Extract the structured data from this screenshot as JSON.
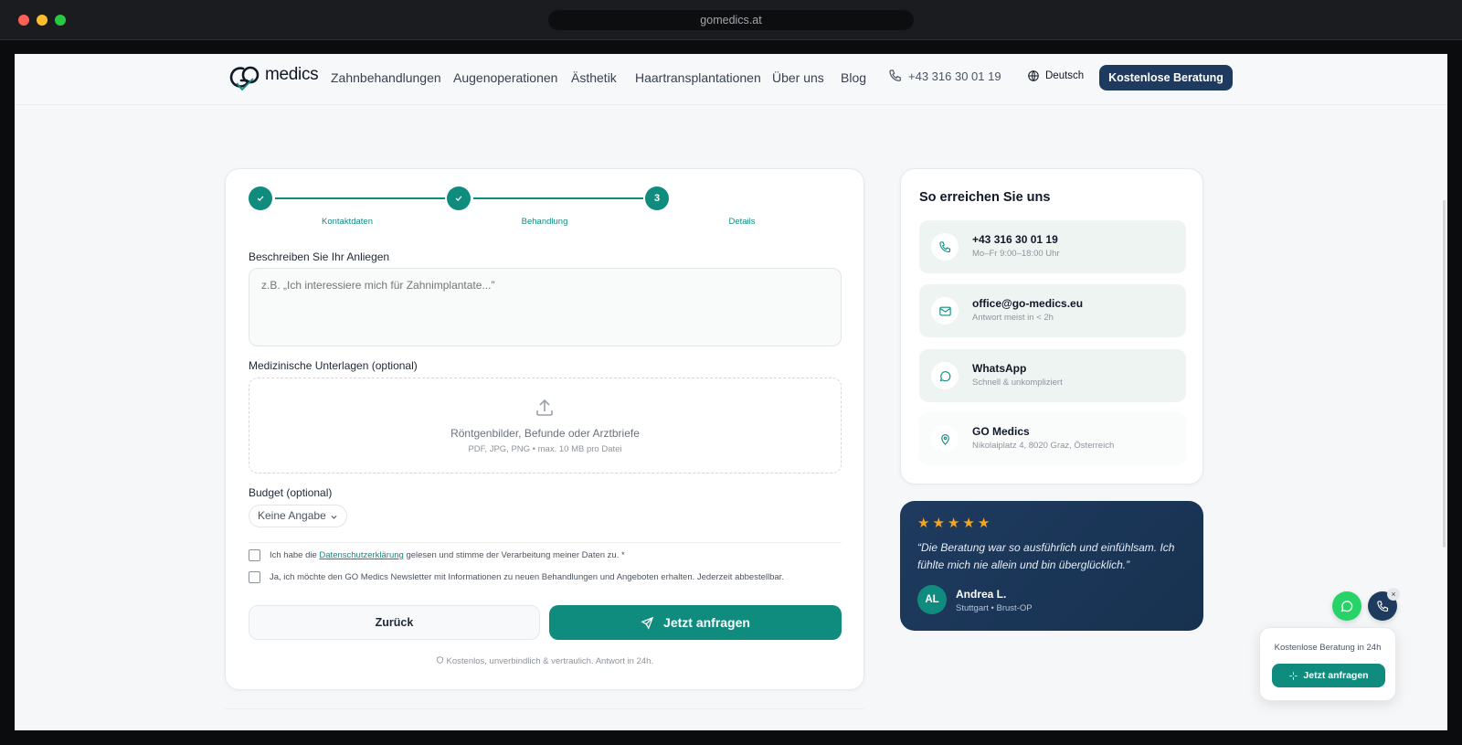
{
  "browser": {
    "url": "gomedics.at"
  },
  "header": {
    "logo_text": "medics",
    "nav": [
      "Zahnbehandlungen",
      "Augenoperationen",
      "Ästhetik",
      "Haartransplantationen",
      "Über uns",
      "Blog"
    ],
    "phone": "+43 316 30 01 19",
    "language": "Deutsch",
    "cta": "Kostenlose Beratung"
  },
  "form": {
    "steps": [
      {
        "number": "1",
        "label": "Kontaktdaten",
        "done": true
      },
      {
        "number": "2",
        "label": "Behandlung",
        "done": true
      },
      {
        "number": "3",
        "label": "Details",
        "done": false
      }
    ],
    "description_label": "Beschreiben Sie Ihr Anliegen",
    "description_placeholder": "z.B. „Ich interessiere mich für Zahnimplantate...\"",
    "upload_label": "Medizinische Unterlagen (optional)",
    "upload_title": "Röntgenbilder, Befunde oder Arztbriefe",
    "upload_sub": "PDF, JPG, PNG • max. 10 MB pro Datei",
    "budget_label": "Budget (optional)",
    "budget_value": "Keine Angabe",
    "privacy_pre": "Ich habe die ",
    "privacy_link": "Datenschutzerklärung",
    "privacy_post": " gelesen und stimme der Verarbeitung meiner Daten zu. *",
    "newsletter": "Ja, ich möchte den GO Medics Newsletter mit Informationen zu neuen Behandlungen und Angeboten erhalten. Jederzeit abbestellbar.",
    "back_button": "Zurück",
    "submit_button": "Jetzt anfragen",
    "footnote": "Kostenlos, unverbindlich & vertraulich. Antwort in 24h."
  },
  "contact": {
    "title": "So erreichen Sie uns",
    "items": [
      {
        "icon": "phone-icon",
        "title": "+43 316 30 01 19",
        "sub": "Mo–Fr 9:00–18:00 Uhr"
      },
      {
        "icon": "mail-icon",
        "title": "office@go-medics.eu",
        "sub": "Antwort meist in < 2h"
      },
      {
        "icon": "whatsapp-icon",
        "title": "WhatsApp",
        "sub": "Schnell & unkompliziert"
      },
      {
        "icon": "location-pin-icon",
        "title": "GO Medics",
        "sub": "Nikolaiplatz 4, 8020 Graz, Österreich"
      }
    ]
  },
  "testimonial": {
    "rating": 5,
    "quote": "“Die Beratung war so ausführlich und einfühlsam. Ich fühlte mich nie allein und bin überglücklich.”",
    "initials": "AL",
    "name": "Andrea L.",
    "meta": "Stuttgart • Brust-OP"
  },
  "floating": {
    "close": "×",
    "popup_text": "Kostenlose Beratung in 24h",
    "popup_button": "Jetzt anfragen"
  },
  "colors": {
    "primary": "#0f8c7e",
    "navy": "#1e3a5f",
    "star": "#f5a524",
    "whatsapp": "#25d366"
  }
}
